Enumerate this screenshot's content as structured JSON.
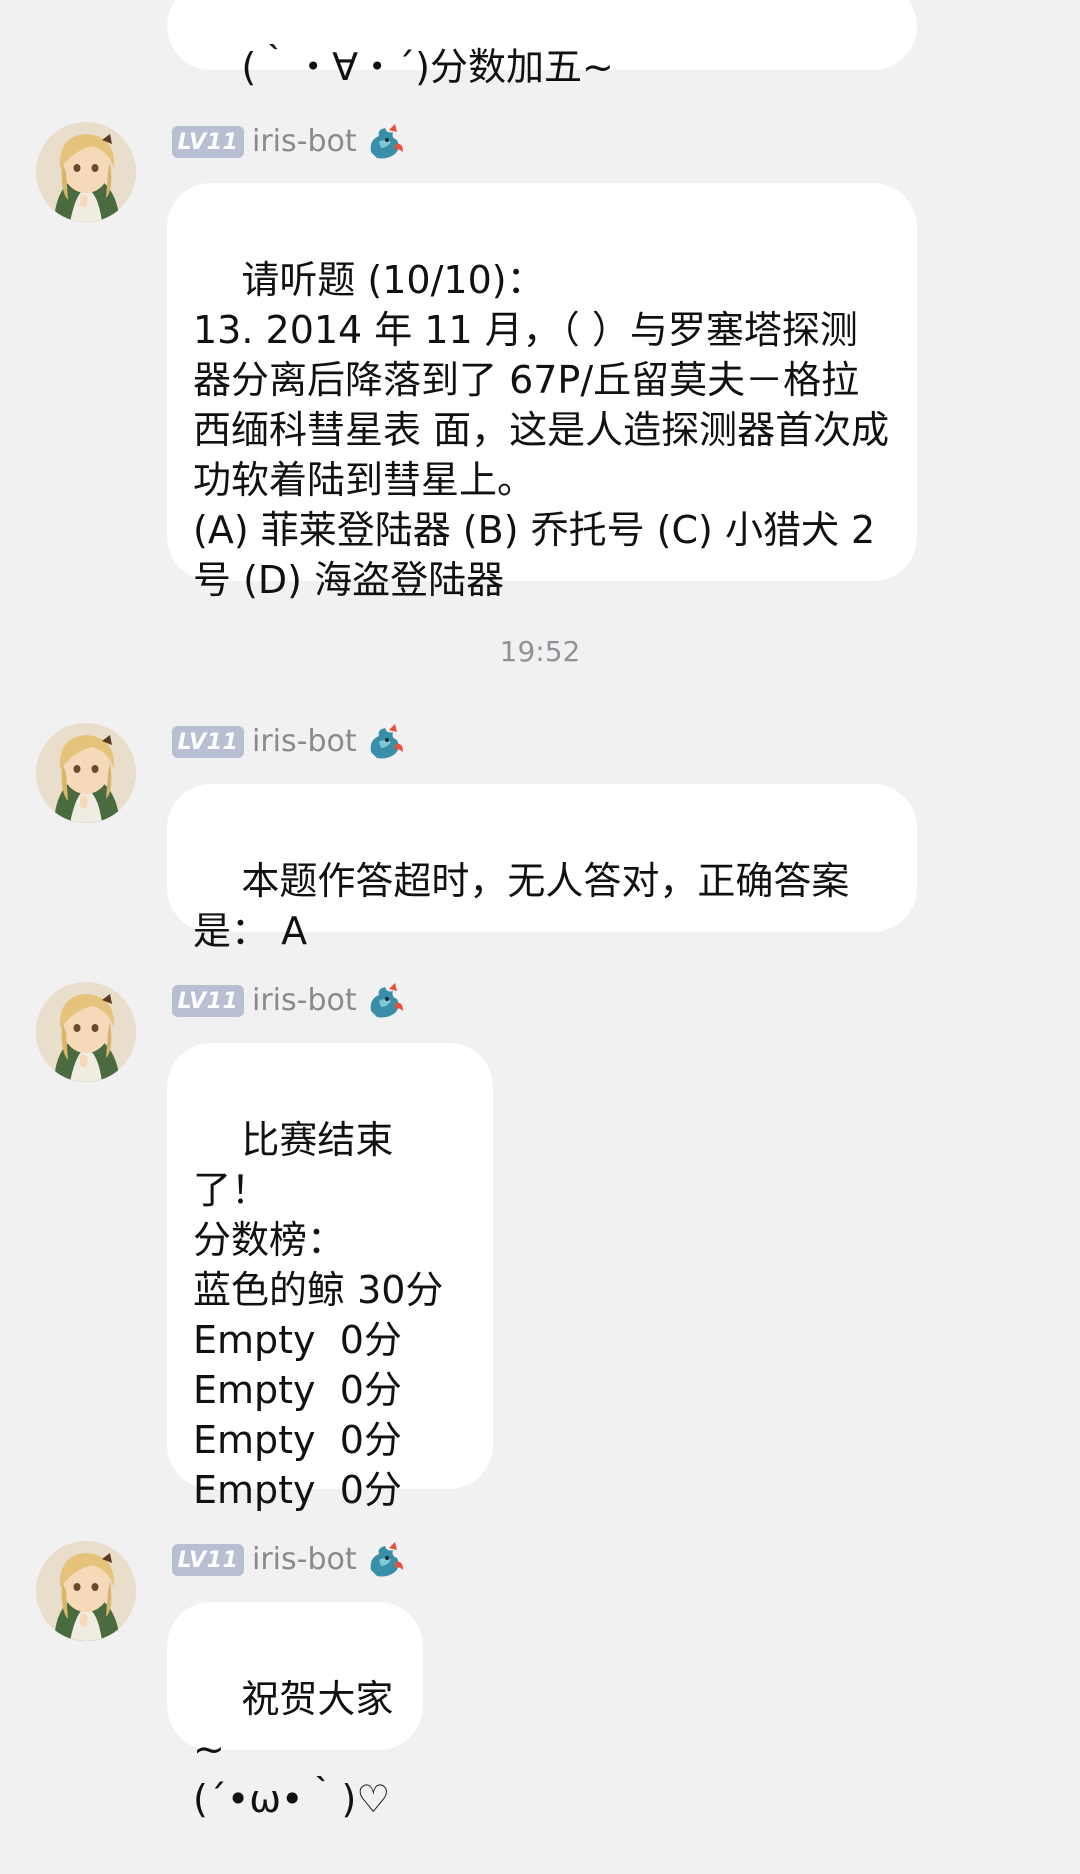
{
  "messages": [
    {
      "text": "(｀・∀・´)分数加五~"
    },
    {
      "sender": {
        "level": "LV11",
        "name": "iris-bot",
        "icon": "dragon-badge-icon"
      },
      "text": "请听题 (10/10)：\n13. 2014 年 11 月，（ ）与罗塞塔探测器分离后降落到了 67P/丘留莫夫－格拉西缅科彗星表 面，这是人造探测器首次成功软着陆到彗星上。\n(A) 菲莱登陆器 (B) 乔托号 (C) 小猎犬 2 号 (D) 海盗登陆器"
    },
    {
      "sender": {
        "level": "LV11",
        "name": "iris-bot",
        "icon": "dragon-badge-icon"
      },
      "text": "本题作答超时，无人答对，正确答案是： A"
    },
    {
      "sender": {
        "level": "LV11",
        "name": "iris-bot",
        "icon": "dragon-badge-icon"
      },
      "text": "比赛结束了！\n分数榜：\n蓝色的鲸 30分\nEmpty  0分\nEmpty  0分\nEmpty  0分\nEmpty  0分\n"
    },
    {
      "sender": {
        "level": "LV11",
        "name": "iris-bot",
        "icon": "dragon-badge-icon"
      },
      "text": "祝贺大家~\n(´•ω•｀)♡"
    }
  ],
  "timestamp": "19:52",
  "colors": {
    "background": "#f1f1f1",
    "bubble": "#ffffff",
    "level_badge": "#b9bfd3",
    "sender_text": "#8a8a8a",
    "timestamp_text": "#8f9399"
  }
}
